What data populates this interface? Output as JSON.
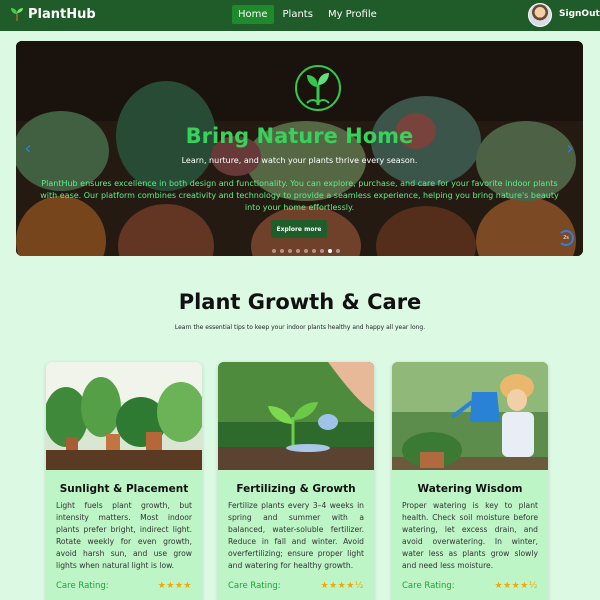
{
  "nav": {
    "brand": "PlantHub",
    "links": [
      {
        "label": "Home",
        "active": true
      },
      {
        "label": "Plants",
        "active": false
      },
      {
        "label": "My Profile",
        "active": false
      }
    ],
    "signout": "SignOut"
  },
  "hero": {
    "title": "Bring Nature Home",
    "subtitle": "Learn, nurture, and watch your plants thrive every season.",
    "description": "PlantHub ensures excellence in both design and functionality. You can explore, purchase, and care for your favorite indoor plants with ease. Our platform combines creativity and technology to provide a seamless experience, helping you bring nature's beauty into your home effortlessly.",
    "button": "Explore more",
    "timer": "2s",
    "slide_count": 9,
    "active_slide": 7
  },
  "section": {
    "title": "Plant Growth & Care",
    "subtitle": "Learn the essential tips to keep your indoor plants healthy and happy all year long."
  },
  "cards": [
    {
      "title": "Sunlight & Placement",
      "text": "Light fuels plant growth, but intensity matters. Most indoor plants prefer bright, indirect light. Rotate weekly for even growth, avoid harsh sun, and use grow lights when natural light is low.",
      "rating_label": "Care Rating:",
      "stars": "★★★★"
    },
    {
      "title": "Fertilizing & Growth",
      "text": "Fertilize plants every 3–4 weeks in spring and summer with a balanced, water-soluble fertilizer. Reduce in fall and winter. Avoid overfertilizing; ensure proper light and watering for healthy growth.",
      "rating_label": "Care Rating:",
      "stars": "★★★★½"
    },
    {
      "title": "Watering Wisdom",
      "text": "Proper watering is key to plant health. Check soil moisture before watering, let excess drain, and avoid overwatering. In winter, water less as plants grow slowly and need less moisture.",
      "rating_label": "Care Rating:",
      "stars": "★★★★½"
    }
  ],
  "colors": {
    "nav_bg": "#1f5c2a",
    "accent_green": "#36d35a",
    "card_bg": "#bdf5c6",
    "page_bg": "#dcf9e4",
    "star": "#f2a800"
  }
}
